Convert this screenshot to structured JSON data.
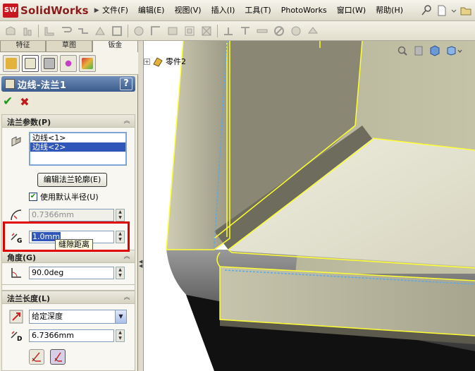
{
  "app": {
    "logo_mark": "SW",
    "logo_text": "SolidWorks",
    "logo_arrow": "▶"
  },
  "menu": [
    "文件(F)",
    "编辑(E)",
    "视图(V)",
    "插入(I)",
    "工具(T)",
    "PhotoWorks",
    "窗口(W)",
    "帮助(H)"
  ],
  "panel": {
    "tabs": [
      "特征",
      "草图",
      "钣金"
    ],
    "active_tab": 2,
    "title": "边线-法兰1",
    "help": "?",
    "ok_glyph": "✔",
    "cancel_glyph": "✖"
  },
  "flange_params": {
    "header": "法兰参数(P)",
    "edges": [
      "边线<1>",
      "边线<2>"
    ],
    "selected_edge": 1,
    "edit_button": "编辑法兰轮廓(E)",
    "use_default_radius_label": "使用默认半径(U)",
    "use_default_radius_checked": true,
    "bend_radius": "0.7366mm",
    "gap_value": "1.0mm",
    "gap_tooltip": "缝隙距离",
    "gap_icon_letter": "G"
  },
  "angle": {
    "header": "角度(G)",
    "value": "90.0deg"
  },
  "flange_length": {
    "header": "法兰长度(L)",
    "end_condition": "给定深度",
    "length": "6.7366mm",
    "length_icon_letter": "D"
  },
  "viewport": {
    "tree_label": "零件2"
  },
  "colors": {
    "selection": "#2f56b8",
    "highlight": "#e00000",
    "edge_yellow": "#ffff33",
    "title_bar": "#3a5b8c"
  }
}
